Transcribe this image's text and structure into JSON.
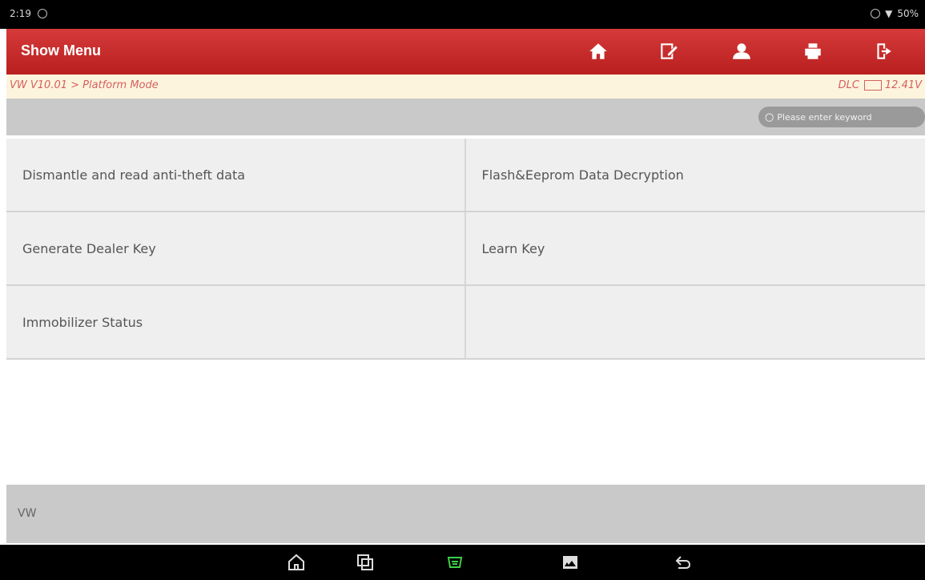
{
  "status": {
    "time": "2:19",
    "battery": "50%"
  },
  "header": {
    "title": "Show Menu"
  },
  "breadcrumb": {
    "path": "VW V10.01 > Platform Mode",
    "dlc": "DLC",
    "voltage": "12.41V"
  },
  "search": {
    "placeholder": "Please enter keyword"
  },
  "menu": {
    "rows": [
      {
        "left": "Dismantle and read anti-theft data",
        "right": "Flash&Eeprom Data Decryption"
      },
      {
        "left": "Generate Dealer Key",
        "right": "Learn Key"
      },
      {
        "left": "Immobilizer Status",
        "right": ""
      }
    ]
  },
  "footer": {
    "brand": "VW"
  },
  "colors": {
    "header_red": "#c92a2a",
    "crumb_bg": "#fdf4dd",
    "crumb_text": "#d56060",
    "nav_green": "#3ecf4a"
  },
  "icons": [
    "home-icon",
    "edit-report-icon",
    "user-icon",
    "print-icon",
    "exit-icon"
  ]
}
